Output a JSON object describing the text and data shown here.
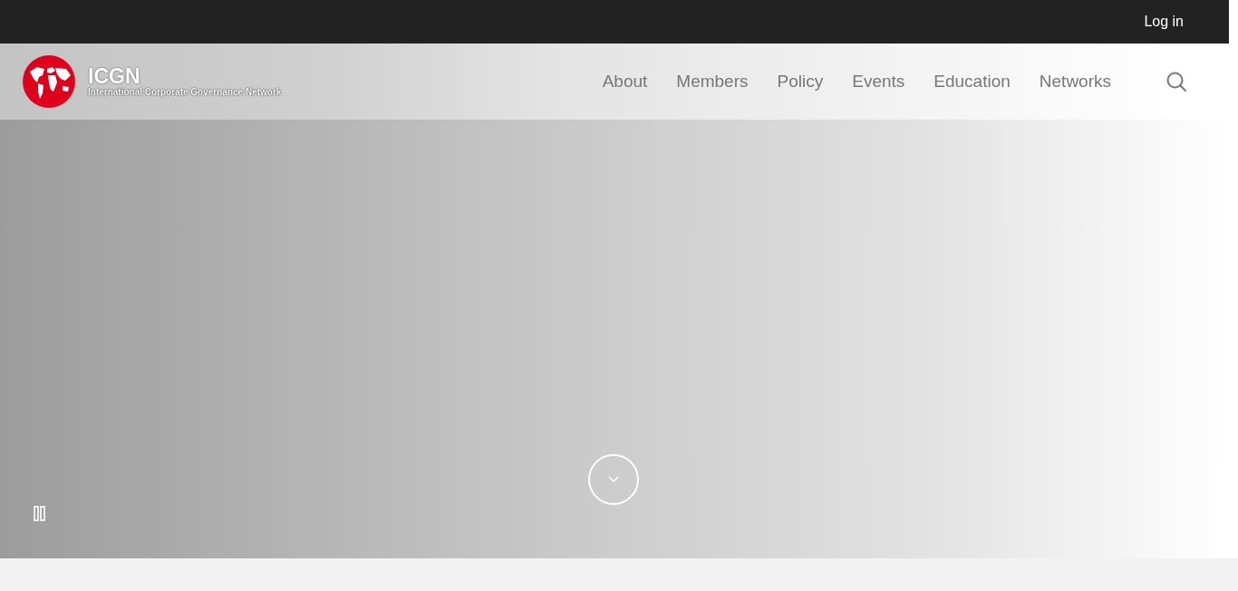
{
  "top_bar": {
    "login": "Log in"
  },
  "logo": {
    "name": "ICGN",
    "tagline": "International Corporate Governance Network"
  },
  "nav": [
    {
      "label": "About"
    },
    {
      "label": "Members"
    },
    {
      "label": "Policy"
    },
    {
      "label": "Events"
    },
    {
      "label": "Education"
    },
    {
      "label": "Networks"
    }
  ]
}
